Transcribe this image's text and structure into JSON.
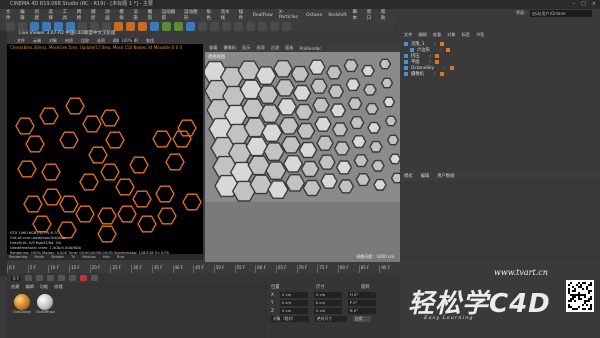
{
  "window": {
    "title": "CINEMA 4D R19.068 Studio (RC - R19) - [未标题 1 *] - 主要"
  },
  "menu": {
    "items": [
      "文件",
      "编辑",
      "创建",
      "选择",
      "工具",
      "网格",
      "捕捉",
      "动画",
      "模拟",
      "渲染",
      "雕刻",
      "运动跟踪",
      "运动图形",
      "角色",
      "流水线",
      "插件",
      "RealFlow",
      "X-Particles",
      "Octane",
      "Redshift",
      "脚本",
      "窗口",
      "帮助"
    ]
  },
  "layout": {
    "label": "界面：",
    "value": "启动(用户)Octane"
  },
  "live_viewer": {
    "title": "Live Viewer 3.07-R2 中国C4D联盟中文汉化版",
    "menu": [
      "文件",
      "云端",
      "对象",
      "材质",
      "比较",
      "选项",
      "帮助",
      "HDR",
      "查找"
    ],
    "zoom": "100%",
    "status": "Check(8ms,30ms), MeshGen:5ms, Update[C]:0ms, Mesh:150 Nodes:34 Movable:0 0 0",
    "stats": [
      "GTX 1060 6GB [1]    7%    6.7C",
      "Out-of-core used/max:0kb/4Gb",
      "Grey8/16: 0/0    Rgb32/64: 0/0",
      "Used/free/total vram: 1.4Gb/4.0Gb/6Gb",
      "Rendering: 100%  Ms/sec: 0.000  Time: 00:00:00/00:00:00  Spp/maxspp: 128/128  Tri: 0/7k"
    ],
    "footer": [
      "Rendering",
      "Mode",
      "Render",
      "Tri",
      "Meshes",
      "Hair",
      "Rnd"
    ]
  },
  "viewport": {
    "menu": [
      "查看",
      "摄像机",
      "显示",
      "选项",
      "过滤",
      "面板",
      "ProRender"
    ],
    "label": "透视视图",
    "zoom": "网格间距：1000 cm"
  },
  "object_manager": {
    "menu": [
      "文件",
      "编辑",
      "查看",
      "对象",
      "标签",
      "书签"
    ],
    "items": [
      {
        "name": "克隆_1",
        "indent": 0
      },
      {
        "name": "六边形",
        "indent": 1
      },
      {
        "name": "挤压",
        "indent": 0
      },
      {
        "name": "平面",
        "indent": 0
      },
      {
        "name": "OctaneSky",
        "indent": 0
      },
      {
        "name": "摄像机",
        "indent": 0
      }
    ]
  },
  "attributes": {
    "menu": [
      "模式",
      "编辑",
      "用户数据"
    ]
  },
  "timeline": {
    "ticks": [
      "0 F",
      "5 F",
      "10 F",
      "15 F",
      "20 F",
      "25 F",
      "30 F",
      "35 F",
      "40 F",
      "45 F",
      "50 F",
      "55 F",
      "60 F",
      "65 F",
      "70 F",
      "75 F",
      "80 F",
      "85 F",
      "90 F"
    ],
    "current": "0 F"
  },
  "materials": {
    "menu": [
      "创建",
      "编辑",
      "功能",
      "纹理"
    ],
    "items": [
      "OctGlossy",
      "OctDiffuse"
    ]
  },
  "coordinates": {
    "headers": [
      "位置",
      "尺寸",
      "旋转"
    ],
    "rows": [
      {
        "axis": "X",
        "pos": "0 cm",
        "size": "0 cm",
        "rot": "H 0°"
      },
      {
        "axis": "Y",
        "pos": "0 cm",
        "size": "0 cm",
        "rot": "P 0°"
      },
      {
        "axis": "Z",
        "pos": "0 cm",
        "size": "0 cm",
        "rot": "B 0°"
      }
    ],
    "mode": "对象（相对）",
    "size_mode": "绝对尺寸",
    "apply": "应用"
  },
  "brand": {
    "url": "www.tvart.cn",
    "logo": "轻松学C4D",
    "slogan": "Easy Learning"
  },
  "colors": {
    "hex_stroke": "#e4731f",
    "bg_dark": "#000000",
    "panel": "#3a3a3a"
  }
}
